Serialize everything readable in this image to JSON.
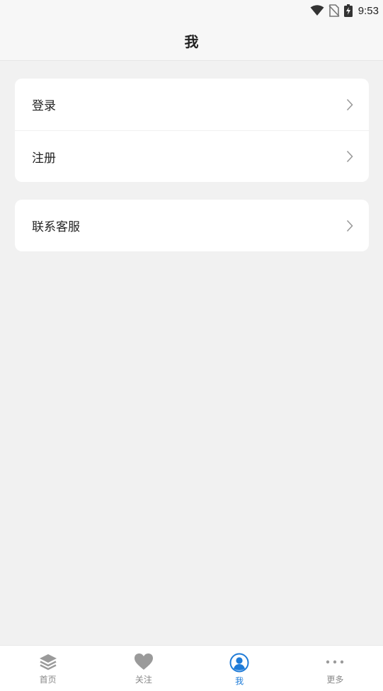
{
  "status_bar": {
    "time": "9:53",
    "icons": [
      "wifi-icon",
      "no-sim-icon",
      "battery-charging-icon"
    ]
  },
  "header": {
    "title": "我"
  },
  "menu": {
    "account": [
      {
        "label": "登录",
        "icon": "chevron-right-icon"
      },
      {
        "label": "注册",
        "icon": "chevron-right-icon"
      }
    ],
    "support": [
      {
        "label": "联系客服",
        "icon": "chevron-right-icon"
      }
    ]
  },
  "tabbar": {
    "active_color": "#1e7bd8",
    "inactive_color": "#999999",
    "tabs": [
      {
        "label": "首页",
        "icon": "layers-icon"
      },
      {
        "label": "关注",
        "icon": "heart-icon"
      },
      {
        "label": "我",
        "icon": "user-icon",
        "active": true
      },
      {
        "label": "更多",
        "icon": "more-icon"
      }
    ]
  }
}
